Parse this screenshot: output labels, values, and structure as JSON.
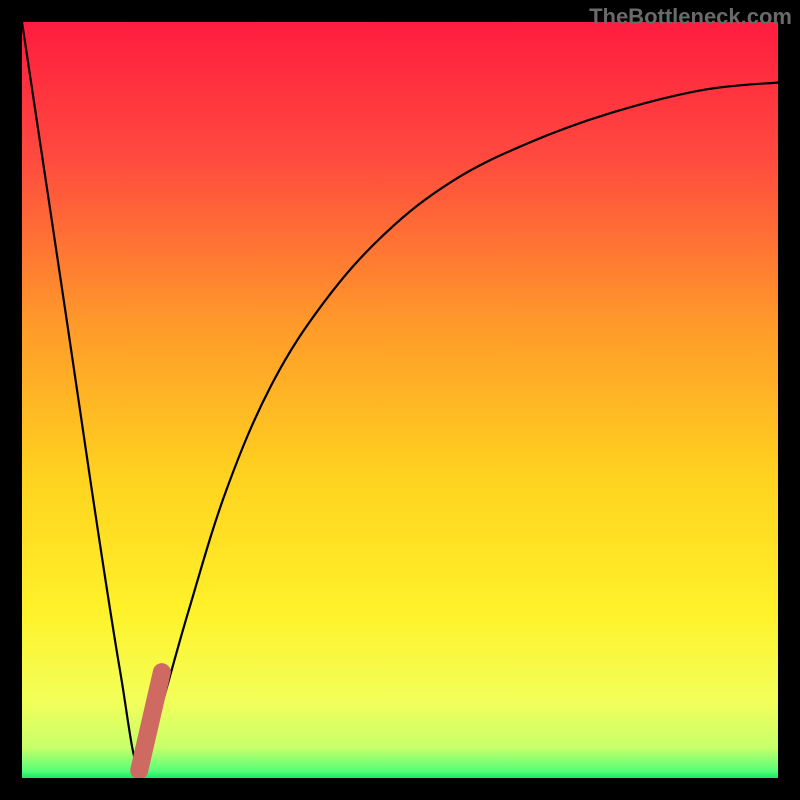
{
  "watermark": "TheBottleneck.com",
  "chart_data": {
    "type": "line",
    "title": "",
    "xlabel": "",
    "ylabel": "",
    "xlim": [
      0,
      100
    ],
    "ylim": [
      0,
      100
    ],
    "series": [
      {
        "name": "bottleneck-curve",
        "x": [
          0,
          6,
          10,
          13,
          15.5,
          18,
          22,
          27,
          33,
          40,
          48,
          57,
          67,
          78,
          90,
          100
        ],
        "values": [
          100,
          60,
          33,
          14,
          1,
          8,
          22,
          38,
          52,
          63,
          72,
          79,
          84,
          88,
          91,
          92
        ]
      },
      {
        "name": "highlight-segment",
        "x": [
          15.5,
          18.5
        ],
        "values": [
          1,
          14
        ]
      }
    ],
    "gradient_stops": [
      {
        "offset": 0,
        "color": "#ff1c3f"
      },
      {
        "offset": 18,
        "color": "#ff4a3f"
      },
      {
        "offset": 40,
        "color": "#ff9a2a"
      },
      {
        "offset": 60,
        "color": "#ffd21f"
      },
      {
        "offset": 78,
        "color": "#fff22a"
      },
      {
        "offset": 90,
        "color": "#f2ff5a"
      },
      {
        "offset": 96,
        "color": "#c6ff6a"
      },
      {
        "offset": 99,
        "color": "#5aff78"
      },
      {
        "offset": 100,
        "color": "#18e868"
      }
    ]
  }
}
